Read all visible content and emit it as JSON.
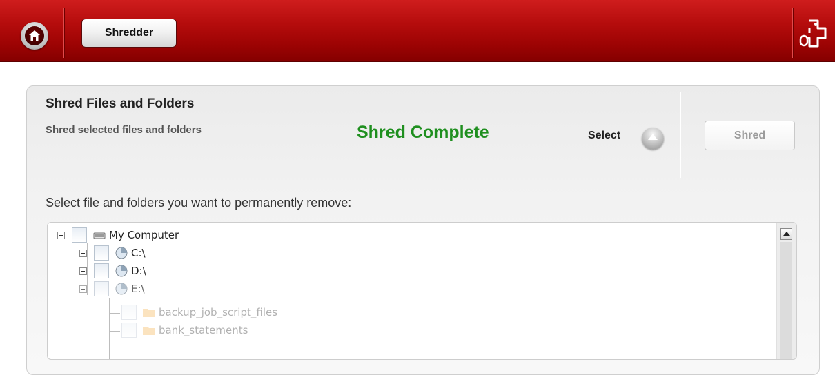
{
  "toolbar": {
    "tab_label": "Shredder"
  },
  "panel": {
    "title": "Shred Files and Folders",
    "subtitle": "Shred selected files and folders",
    "status": "Shred Complete",
    "select_label": "Select",
    "shred_label": "Shred",
    "instruction": "Select file and folders you want to permanently remove:"
  },
  "tree": {
    "root": {
      "label": "My Computer",
      "icon": "computer-icon",
      "expanded": true
    },
    "drives": [
      {
        "label": "C:\\",
        "icon": "drive-icon",
        "expanded": false
      },
      {
        "label": "D:\\",
        "icon": "drive-icon",
        "expanded": false
      },
      {
        "label": "E:\\",
        "icon": "drive-icon",
        "expanded": true
      }
    ],
    "folders": [
      {
        "label": "backup_job_script_files",
        "icon": "folder-icon"
      },
      {
        "label": "bank_statements",
        "icon": "folder-icon"
      }
    ]
  },
  "colors": {
    "header": "#9c0303",
    "status": "#1f8f1f"
  }
}
